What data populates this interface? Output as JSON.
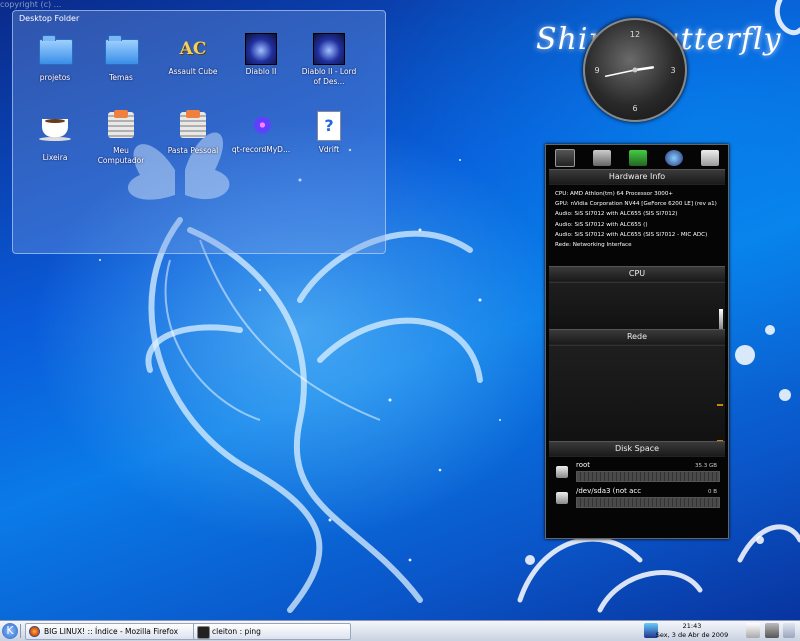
{
  "wallpaper": {
    "watermark": "copyright (c) ...",
    "title": "Shiny Butterfly"
  },
  "desktop_folder": {
    "title": "Desktop Folder",
    "icons": [
      {
        "label": "projetos",
        "icon": "folder-icon"
      },
      {
        "label": "Temas",
        "icon": "folder-icon"
      },
      {
        "label": "Assault Cube",
        "icon": "assault-cube-icon",
        "glyph": "AC"
      },
      {
        "label": "Diablo II",
        "icon": "diablo-icon"
      },
      {
        "label": "Diablo II - Lord of Des...",
        "icon": "diablo-icon"
      },
      {
        "label": "Lixeira",
        "icon": "trash-cup-icon"
      },
      {
        "label": "Meu Computador",
        "icon": "computer-icon"
      },
      {
        "label": "Pasta Pessoal",
        "icon": "home-folder-icon"
      },
      {
        "label": "qt-recordMyD...",
        "icon": "qt-record-icon"
      },
      {
        "label": "Vdrift",
        "icon": "document-icon",
        "glyph": "?"
      }
    ]
  },
  "clock": {
    "numerals": [
      "12",
      "3",
      "6",
      "9"
    ],
    "hour": 2,
    "minute": 43
  },
  "monitor": {
    "icon_names": [
      "cpu-icon",
      "memory-icon",
      "network-icon",
      "globe-icon",
      "disk-icon"
    ],
    "hardware_header": "Hardware Info",
    "hardware_lines": [
      "CPU:  AMD Athlon(tm) 64 Processor 3000+",
      "GPU:  nVidia Corporation NV44 [GeForce 6200 LE] (rev a1)",
      "Audio:  SiS SI7012 with ALC655 (SIS SI7012)",
      "Audio:  SiS SI7012 with ALC655 ()",
      "Audio:  SiS SI7012 with ALC655 (SIS SI7012 - MIC ADC)",
      "Rede:  Networking Interface"
    ],
    "cpu_header": "CPU",
    "net_header": "Rede",
    "disk_header": "Disk Space",
    "disks": [
      {
        "name": "root",
        "size": "35.3 GB",
        "used_fraction": 0.0
      },
      {
        "name": "/dev/sda3 (not acc",
        "size": "0 B",
        "used_fraction": 0.0
      }
    ]
  },
  "taskbar": {
    "kmenu_glyph": "K",
    "tasks": [
      {
        "label": "BIG LINUX! :: Índice - Mozilla Firefox",
        "icon": "firefox-icon"
      },
      {
        "label": "cleiton : ping",
        "icon": "terminal-icon"
      }
    ],
    "time": "21:43",
    "date": "Sex, 3 de Abr de 2009",
    "accent": "#2a62c0"
  }
}
